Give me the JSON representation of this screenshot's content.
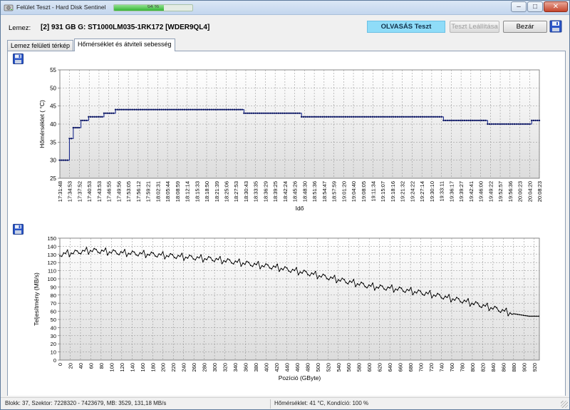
{
  "window": {
    "title": "Felület Teszt - Hard Disk Sentinel",
    "progress_percent": 64,
    "progress_label": "64 %",
    "minimize": "–",
    "maximize": "□",
    "close": "✕"
  },
  "disk": {
    "label": "Lemez:",
    "value": "[2] 931 GB G: ST1000LM035-1RK172 [WDER9QL4]"
  },
  "toolbar": {
    "test_label": "OLVASÁS Teszt",
    "stop_label": "Teszt Leállítása",
    "close_label": "Bezár"
  },
  "tabs": [
    {
      "label": "Lemez felületi térkép",
      "active": false
    },
    {
      "label": "Hőmérséklet és átviteli sebesség",
      "active": true
    }
  ],
  "chart_data": [
    {
      "type": "line",
      "title": "",
      "xlabel": "Idő",
      "ylabel": "Hőmérséklet ( °C)",
      "ylim": [
        25,
        55
      ],
      "yticks": [
        25,
        30,
        35,
        40,
        45,
        50,
        55
      ],
      "grid": true,
      "legend": "none",
      "line_color": "#1a2a8c",
      "x_tick_labels": [
        "17:31:48",
        "17:34:53",
        "17:37:52",
        "17:40:53",
        "17:43:53",
        "17:46:55",
        "17:49:56",
        "17:53:05",
        "17:56:12",
        "17:59:21",
        "18:02:31",
        "18:05:44",
        "18:08:59",
        "18:12:14",
        "18:15:33",
        "18:18:50",
        "18:21:39",
        "18:25:06",
        "18:27:53",
        "18:30:43",
        "18:33:35",
        "18:36:29",
        "18:39:25",
        "18:42:24",
        "18:45:26",
        "18:48:30",
        "18:51:36",
        "18:54:47",
        "18:57:59",
        "19:01:20",
        "19:04:40",
        "19:08:05",
        "19:11:34",
        "19:15:07",
        "19:18:16",
        "19:21:32",
        "19:24:22",
        "19:27:14",
        "19:30:10",
        "19:33:11",
        "19:36:17",
        "19:39:27",
        "19:42:41",
        "19:46:00",
        "19:49:22",
        "19:52:57",
        "19:56:36",
        "20:00:23",
        "20:04:20",
        "20:08:23"
      ],
      "steps": [
        {
          "from": 0,
          "to": 4.5,
          "value": 30
        },
        {
          "from": 4.5,
          "to": 6.5,
          "value": 36
        },
        {
          "from": 6.5,
          "to": 10.2,
          "value": 39
        },
        {
          "from": 10.2,
          "to": 14.5,
          "value": 41
        },
        {
          "from": 14.5,
          "to": 22.8,
          "value": 42
        },
        {
          "from": 22.8,
          "to": 28.5,
          "value": 43
        },
        {
          "from": 28.5,
          "to": 95.5,
          "value": 44
        },
        {
          "from": 95.5,
          "to": 125.5,
          "value": 43
        },
        {
          "from": 125.5,
          "to": 200,
          "value": 42
        },
        {
          "from": 200,
          "to": 222.5,
          "value": 41
        },
        {
          "from": 222.5,
          "to": 245.5,
          "value": 40
        },
        {
          "from": 245.5,
          "to": 251,
          "value": 41
        }
      ],
      "x_count": 251
    },
    {
      "type": "line",
      "title": "",
      "xlabel": "Pozíció (GByte)",
      "ylabel": "Teljesítmény (MB/s)",
      "xlim": [
        0,
        930
      ],
      "ylim": [
        0,
        150
      ],
      "yticks": [
        0,
        10,
        20,
        30,
        40,
        50,
        60,
        70,
        80,
        90,
        100,
        110,
        120,
        130,
        140,
        150
      ],
      "xticks": [
        0,
        20,
        40,
        60,
        80,
        100,
        120,
        140,
        160,
        180,
        200,
        220,
        240,
        260,
        280,
        300,
        320,
        340,
        360,
        380,
        400,
        420,
        440,
        460,
        480,
        500,
        520,
        540,
        560,
        580,
        600,
        620,
        640,
        660,
        680,
        700,
        720,
        740,
        760,
        780,
        800,
        820,
        840,
        860,
        880,
        900,
        920
      ],
      "grid": true,
      "legend": "none",
      "line_color": "#000000",
      "x": [
        0,
        60,
        120,
        180,
        240,
        300,
        360,
        420,
        480,
        540,
        600,
        660,
        720,
        780,
        840,
        880,
        910,
        930
      ],
      "y": [
        130,
        135,
        132,
        130,
        127,
        124,
        119,
        114,
        107,
        99,
        91,
        87,
        81,
        73,
        64,
        57,
        54,
        54
      ]
    }
  ],
  "status": {
    "left": "Blokk: 37, Szektor: 7228320 - 7423679, MB: 3529, 131,18 MB/s",
    "right": "Hőmérséklet: 41  °C,  Kondíció: 100 %"
  }
}
